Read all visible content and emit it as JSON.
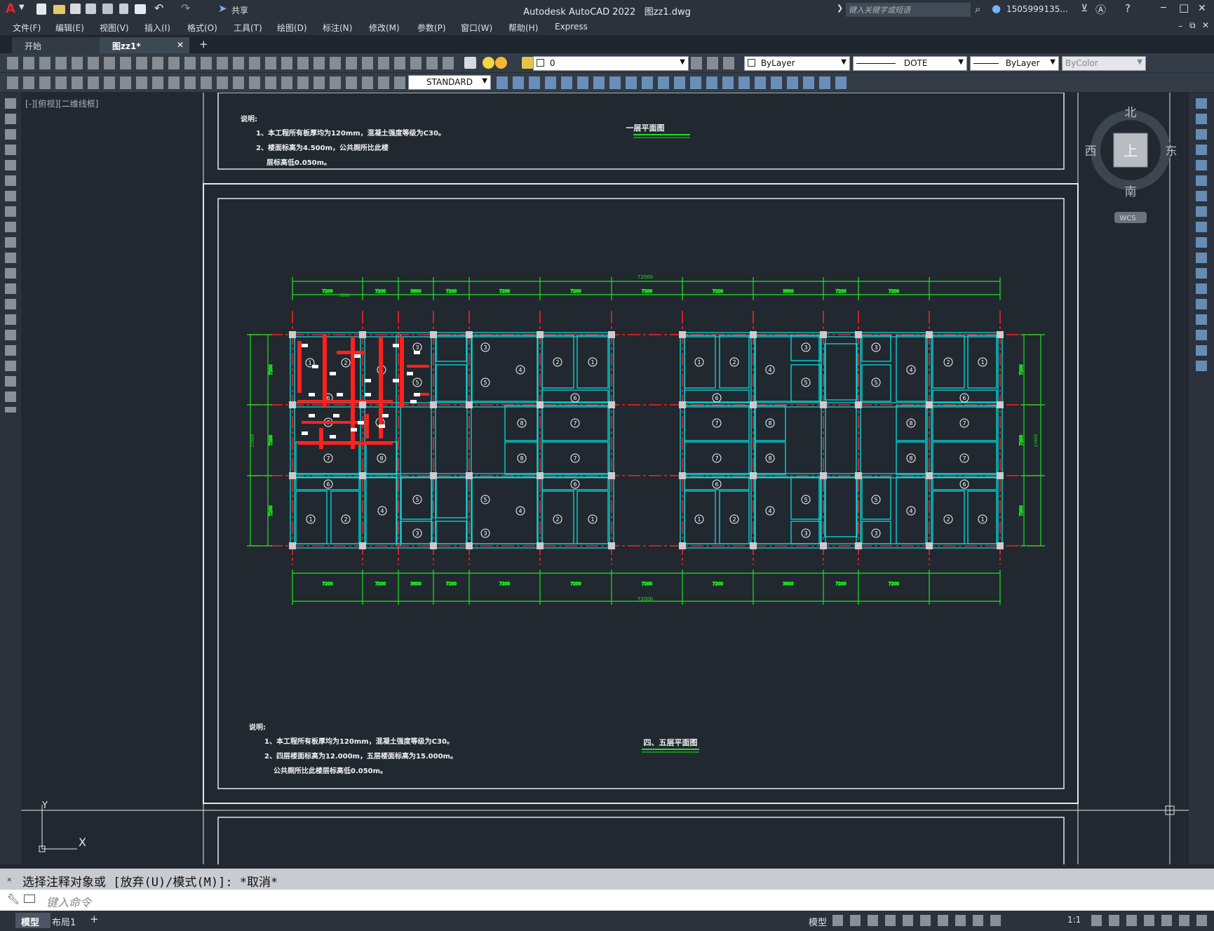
{
  "app": {
    "logo": "A",
    "title": "Autodesk AutoCAD 2022",
    "filename": "图zz1.dwg",
    "share": "共享",
    "search_placeholder": "键入关键字或短语",
    "user": "1505999135...",
    "minimize": "─",
    "maximize": "□",
    "close": "✕"
  },
  "menu": [
    "文件(F)",
    "编辑(E)",
    "视图(V)",
    "插入(I)",
    "格式(O)",
    "工具(T)",
    "绘图(D)",
    "标注(N)",
    "修改(M)",
    "参数(P)",
    "窗口(W)",
    "帮助(H)",
    "Express"
  ],
  "tabs": {
    "start": "开始",
    "current": "图zz1*",
    "add": "+"
  },
  "layer": {
    "current": "0"
  },
  "props": {
    "color": "ByLayer",
    "linetype": "DOTE",
    "lineweight": "ByLayer",
    "plotstyle": "ByColor"
  },
  "textstyle": "STANDARD",
  "viewport_label": "[-][俯视][二维线框]",
  "viewcube": {
    "north": "北",
    "south": "南",
    "east": "东",
    "west": "西",
    "face": "上",
    "wcs": "WCS"
  },
  "drawing": {
    "top_title": "一层平面图",
    "top_notes": [
      "说明:",
      "1、本工程所有板厚均为120mm，混凝土强度等级为C30。",
      "2、楼面标高为4.500m，公共厕所比此楼",
      "层标高低0.050m。"
    ],
    "main_title": "四、五层平面图",
    "main_notes": [
      "说明:",
      "1、本工程所有板厚均为120mm，混凝土强度等级为C30。",
      "2、四层楼面标高为12.000m，五层楼面标高为15.000m。",
      "公共厕所比此楼层标高低0.050m。"
    ],
    "overall_dim": "72000",
    "top_dims": [
      "7200",
      "7200",
      "3600",
      "7200",
      "7200",
      "7200",
      "7200",
      "7200",
      "3600",
      "7200",
      "7200"
    ],
    "bottom_dims": [
      "7200",
      "7200",
      "3600",
      "7200",
      "7200",
      "7200",
      "7200",
      "7200",
      "3600",
      "7200",
      "7200"
    ],
    "side_dims": [
      "7200",
      "7200",
      "7200"
    ],
    "side_total": "21600",
    "dim_3600": "3600"
  },
  "ucs": {
    "x": "X",
    "y": "Y"
  },
  "command": {
    "history": "选择注释对象或 [放弃(U)/模式(M)]: *取消*",
    "placeholder": "键入命令"
  },
  "status": {
    "model_tab": "模型",
    "layout1": "布局1",
    "add": "+",
    "model": "模型",
    "scale": "1:1"
  }
}
